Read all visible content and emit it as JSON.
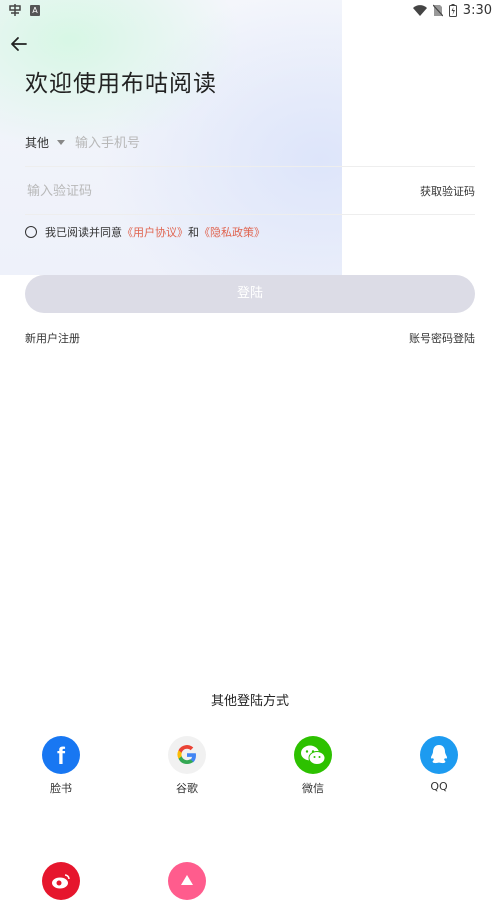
{
  "status_bar": {
    "time": "3:30",
    "badge": "A"
  },
  "page": {
    "title": "欢迎使用布咕阅读"
  },
  "form": {
    "region_label": "其他",
    "phone_placeholder": "输入手机号",
    "code_placeholder": "输入验证码",
    "get_code_label": "获取验证码"
  },
  "agreement": {
    "prefix": "我已阅读并同意",
    "user_agreement": "《用户协议》",
    "and": "和",
    "privacy_policy": "《隐私政策》"
  },
  "login_button": "登陆",
  "links": {
    "register": "新用户注册",
    "password_login": "账号密码登陆"
  },
  "other_login": {
    "title": "其他登陆方式",
    "methods": [
      {
        "label": "脸书",
        "icon": "facebook-icon",
        "color": "#1877f2"
      },
      {
        "label": "谷歌",
        "icon": "google-icon",
        "color": "#f1f1f1"
      },
      {
        "label": "微信",
        "icon": "wechat-icon",
        "color": "#2dc100"
      },
      {
        "label": "QQ",
        "icon": "qq-icon",
        "color": "#1d9bf0"
      },
      {
        "label": "",
        "icon": "weibo-icon",
        "color": "#e6162d"
      },
      {
        "label": "",
        "icon": "pink-app-icon",
        "color": "#ff5c8d"
      }
    ]
  }
}
